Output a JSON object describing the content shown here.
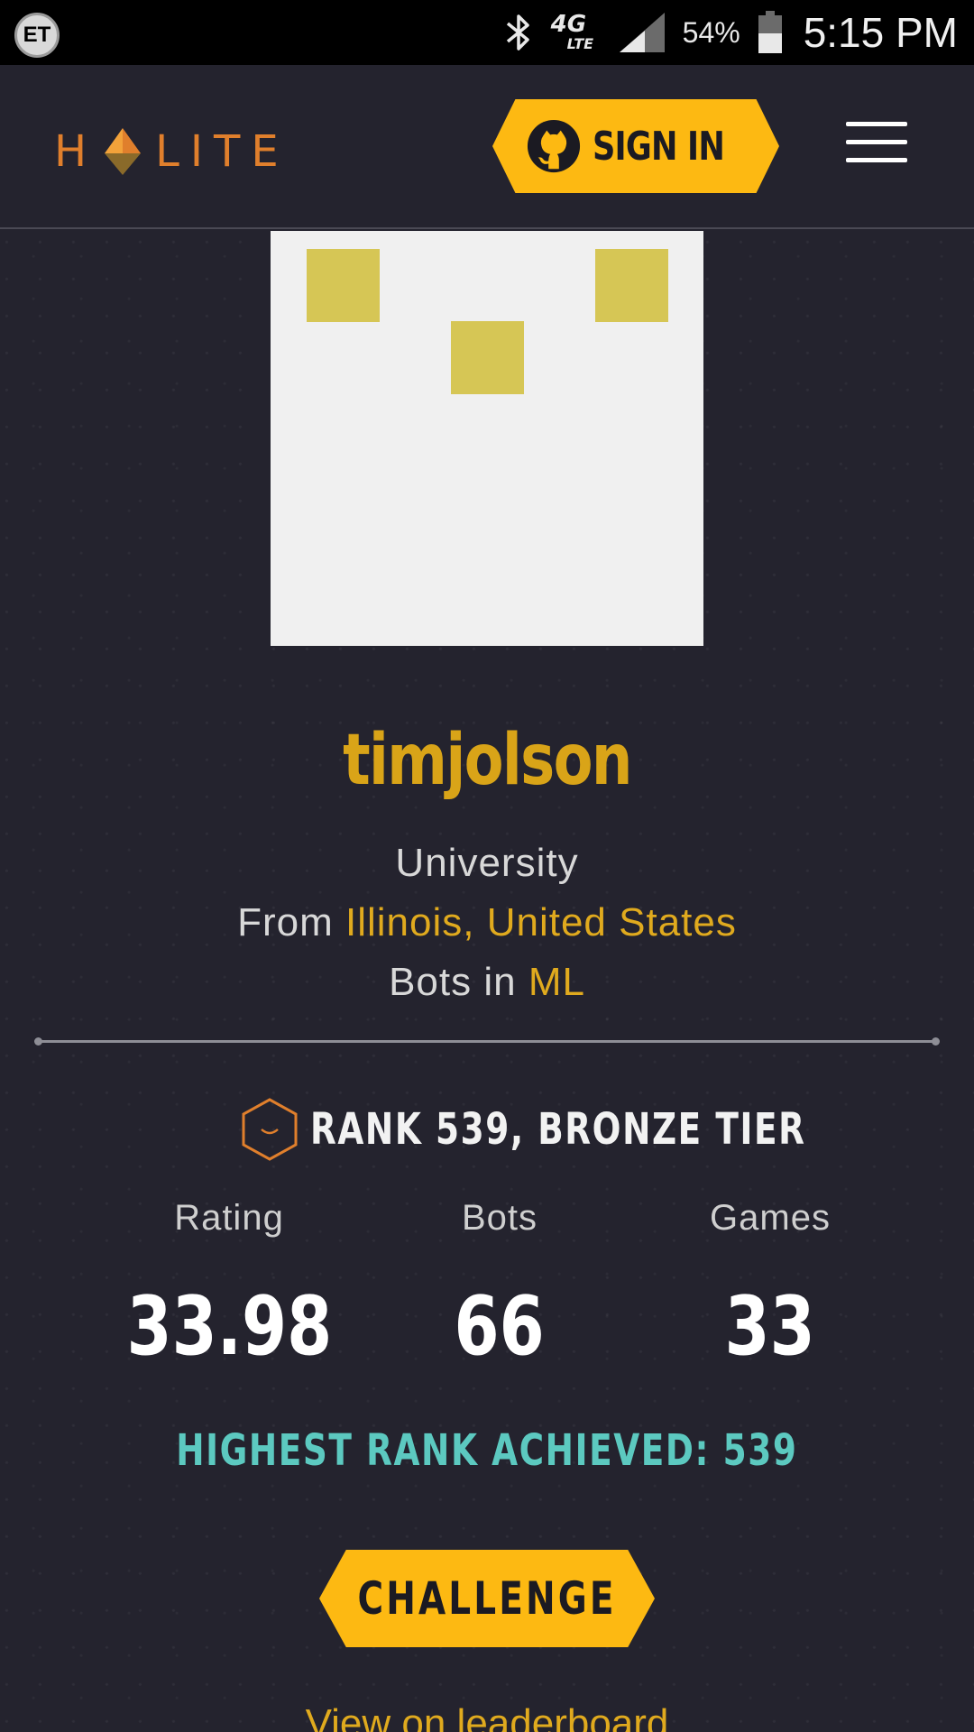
{
  "status_bar": {
    "carrier_badge": "ET",
    "bluetooth_icon": "bluetooth-icon",
    "network": "4G",
    "network_sub": "LTE",
    "signal_icon": "cell-signal-icon",
    "battery_percent": "54%",
    "battery_icon": "battery-icon",
    "time": "5:15 PM"
  },
  "header": {
    "logo_left": "H",
    "logo_right": "LITE",
    "logo_icon": "halite-gem-icon",
    "signin_label": "SIGN IN",
    "signin_icon": "github-icon",
    "menu_icon": "hamburger-menu-icon"
  },
  "profile": {
    "username": "timjolson",
    "level": "University",
    "from_prefix": "From",
    "location": "Illinois, United States",
    "bots_prefix": "Bots in",
    "language": "ML"
  },
  "rank": {
    "tier_icon": "bronze-tier-hexagon-icon",
    "text": "RANK 539, BRONZE TIER"
  },
  "stats": [
    {
      "label": "Rating",
      "value": "33.98"
    },
    {
      "label": "Bots",
      "value": "66"
    },
    {
      "label": "Games",
      "value": "33"
    }
  ],
  "highest_rank": "HIGHEST RANK ACHIEVED: 539",
  "challenge_label": "CHALLENGE",
  "leaderboard_link": "View on leaderboard",
  "colors": {
    "accent_yellow": "#fdb912",
    "username": "#d9a418",
    "highlight": "#e0aa1e",
    "teal": "#5cc9c0",
    "logo_orange": "#e07f2c",
    "background": "#24232e",
    "identicon": "#d6c655"
  }
}
